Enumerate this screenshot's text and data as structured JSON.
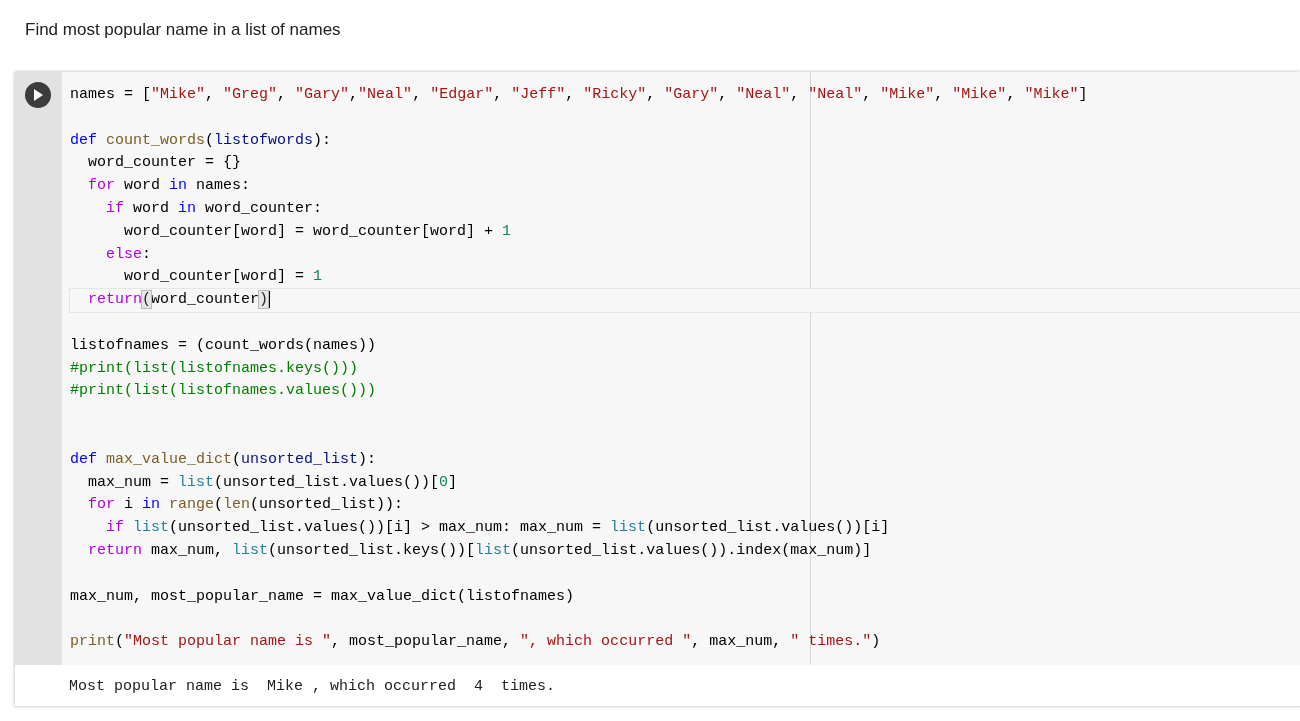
{
  "heading": "Find most popular name in a list of names",
  "cell": {
    "lines": [
      {
        "kind": "code",
        "active": false,
        "tokens": [
          {
            "kind": "plain",
            "text": "names = ["
          },
          {
            "kind": "string",
            "text": "\"Mike\""
          },
          {
            "kind": "plain",
            "text": ", "
          },
          {
            "kind": "string",
            "text": "\"Greg\""
          },
          {
            "kind": "plain",
            "text": ", "
          },
          {
            "kind": "string",
            "text": "\"Gary\""
          },
          {
            "kind": "plain",
            "text": ","
          },
          {
            "kind": "string",
            "text": "\"Neal\""
          },
          {
            "kind": "plain",
            "text": ", "
          },
          {
            "kind": "string",
            "text": "\"Edgar\""
          },
          {
            "kind": "plain",
            "text": ", "
          },
          {
            "kind": "string",
            "text": "\"Jeff\""
          },
          {
            "kind": "plain",
            "text": ", "
          },
          {
            "kind": "string",
            "text": "\"Ricky\""
          },
          {
            "kind": "plain",
            "text": ", "
          },
          {
            "kind": "string",
            "text": "\"Gary\""
          },
          {
            "kind": "plain",
            "text": ", "
          },
          {
            "kind": "string",
            "text": "\"Neal\""
          },
          {
            "kind": "plain",
            "text": ", "
          },
          {
            "kind": "string",
            "text": "\"Neal\""
          },
          {
            "kind": "plain",
            "text": ", "
          },
          {
            "kind": "string",
            "text": "\"Mike\""
          },
          {
            "kind": "plain",
            "text": ", "
          },
          {
            "kind": "string",
            "text": "\"Mike\""
          },
          {
            "kind": "plain",
            "text": ", "
          },
          {
            "kind": "string",
            "text": "\"Mike\""
          },
          {
            "kind": "plain",
            "text": "]"
          }
        ]
      },
      {
        "kind": "blank"
      },
      {
        "kind": "code",
        "active": false,
        "tokens": [
          {
            "kind": "keyword",
            "text": "def "
          },
          {
            "kind": "function",
            "text": "count_words"
          },
          {
            "kind": "plain",
            "text": "("
          },
          {
            "kind": "param",
            "text": "listofwords"
          },
          {
            "kind": "plain",
            "text": "):"
          }
        ]
      },
      {
        "kind": "code",
        "active": false,
        "tokens": [
          {
            "kind": "plain",
            "text": "  word_counter = {}"
          }
        ]
      },
      {
        "kind": "code",
        "active": false,
        "tokens": [
          {
            "kind": "control",
            "text": "  for"
          },
          {
            "kind": "plain",
            "text": " word "
          },
          {
            "kind": "keyword",
            "text": "in"
          },
          {
            "kind": "plain",
            "text": " names:"
          }
        ]
      },
      {
        "kind": "code",
        "active": false,
        "tokens": [
          {
            "kind": "control",
            "text": "    if"
          },
          {
            "kind": "plain",
            "text": " word "
          },
          {
            "kind": "keyword",
            "text": "in"
          },
          {
            "kind": "plain",
            "text": " word_counter:"
          }
        ]
      },
      {
        "kind": "code",
        "active": false,
        "tokens": [
          {
            "kind": "plain",
            "text": "      word_counter[word] = word_counter[word] + "
          },
          {
            "kind": "number",
            "text": "1"
          }
        ]
      },
      {
        "kind": "code",
        "active": false,
        "tokens": [
          {
            "kind": "control",
            "text": "    else"
          },
          {
            "kind": "plain",
            "text": ":"
          }
        ]
      },
      {
        "kind": "code",
        "active": false,
        "tokens": [
          {
            "kind": "plain",
            "text": "      word_counter[word] = "
          },
          {
            "kind": "number",
            "text": "1"
          }
        ]
      },
      {
        "kind": "code",
        "active": true,
        "tokens": [
          {
            "kind": "control",
            "text": "  return"
          },
          {
            "kind": "bracket",
            "text": "("
          },
          {
            "kind": "plain",
            "text": "word_counter"
          },
          {
            "kind": "bracket",
            "text": ")"
          }
        ]
      },
      {
        "kind": "blank"
      },
      {
        "kind": "code",
        "active": false,
        "tokens": [
          {
            "kind": "plain",
            "text": "listofnames = (count_words(names))"
          }
        ]
      },
      {
        "kind": "code",
        "active": false,
        "tokens": [
          {
            "kind": "comment",
            "text": "#print(list(listofnames.keys()))"
          }
        ]
      },
      {
        "kind": "code",
        "active": false,
        "tokens": [
          {
            "kind": "comment",
            "text": "#print(list(listofnames.values()))"
          }
        ]
      },
      {
        "kind": "blank"
      },
      {
        "kind": "blank"
      },
      {
        "kind": "code",
        "active": false,
        "tokens": [
          {
            "kind": "keyword",
            "text": "def "
          },
          {
            "kind": "function",
            "text": "max_value_dict"
          },
          {
            "kind": "plain",
            "text": "("
          },
          {
            "kind": "param",
            "text": "unsorted_list"
          },
          {
            "kind": "plain",
            "text": "):"
          }
        ]
      },
      {
        "kind": "code",
        "active": false,
        "tokens": [
          {
            "kind": "plain",
            "text": "  max_num = "
          },
          {
            "kind": "builtin",
            "text": "list"
          },
          {
            "kind": "plain",
            "text": "(unsorted_list.values())["
          },
          {
            "kind": "number",
            "text": "0"
          },
          {
            "kind": "plain",
            "text": "]"
          }
        ]
      },
      {
        "kind": "code",
        "active": false,
        "tokens": [
          {
            "kind": "control",
            "text": "  for"
          },
          {
            "kind": "plain",
            "text": " i "
          },
          {
            "kind": "keyword",
            "text": "in "
          },
          {
            "kind": "function",
            "text": "range"
          },
          {
            "kind": "plain",
            "text": "("
          },
          {
            "kind": "function",
            "text": "len"
          },
          {
            "kind": "plain",
            "text": "(unsorted_list)):"
          }
        ]
      },
      {
        "kind": "code",
        "active": false,
        "tokens": [
          {
            "kind": "control",
            "text": "    if "
          },
          {
            "kind": "builtin",
            "text": "list"
          },
          {
            "kind": "plain",
            "text": "(unsorted_list.values())[i] > max_num: max_num = "
          },
          {
            "kind": "builtin",
            "text": "list"
          },
          {
            "kind": "plain",
            "text": "(unsorted_list.values())[i]"
          }
        ]
      },
      {
        "kind": "code",
        "active": false,
        "tokens": [
          {
            "kind": "control",
            "text": "  return"
          },
          {
            "kind": "plain",
            "text": " max_num, "
          },
          {
            "kind": "builtin",
            "text": "list"
          },
          {
            "kind": "plain",
            "text": "(unsorted_list.keys())["
          },
          {
            "kind": "builtin",
            "text": "list"
          },
          {
            "kind": "plain",
            "text": "(unsorted_list.values()).index(max_num)]"
          }
        ]
      },
      {
        "kind": "blank"
      },
      {
        "kind": "code",
        "active": false,
        "tokens": [
          {
            "kind": "plain",
            "text": "max_num, most_popular_name = max_value_dict(listofnames)"
          }
        ]
      },
      {
        "kind": "blank"
      },
      {
        "kind": "code",
        "active": false,
        "tokens": [
          {
            "kind": "function",
            "text": "print"
          },
          {
            "kind": "plain",
            "text": "("
          },
          {
            "kind": "string",
            "text": "\"Most popular name is \""
          },
          {
            "kind": "plain",
            "text": ", most_popular_name, "
          },
          {
            "kind": "string",
            "text": "\", which occurred \""
          },
          {
            "kind": "plain",
            "text": ", max_num, "
          },
          {
            "kind": "string",
            "text": "\" times.\""
          },
          {
            "kind": "plain",
            "text": ")"
          }
        ]
      }
    ],
    "output": "Most popular name is  Mike , which occurred  4  times."
  }
}
